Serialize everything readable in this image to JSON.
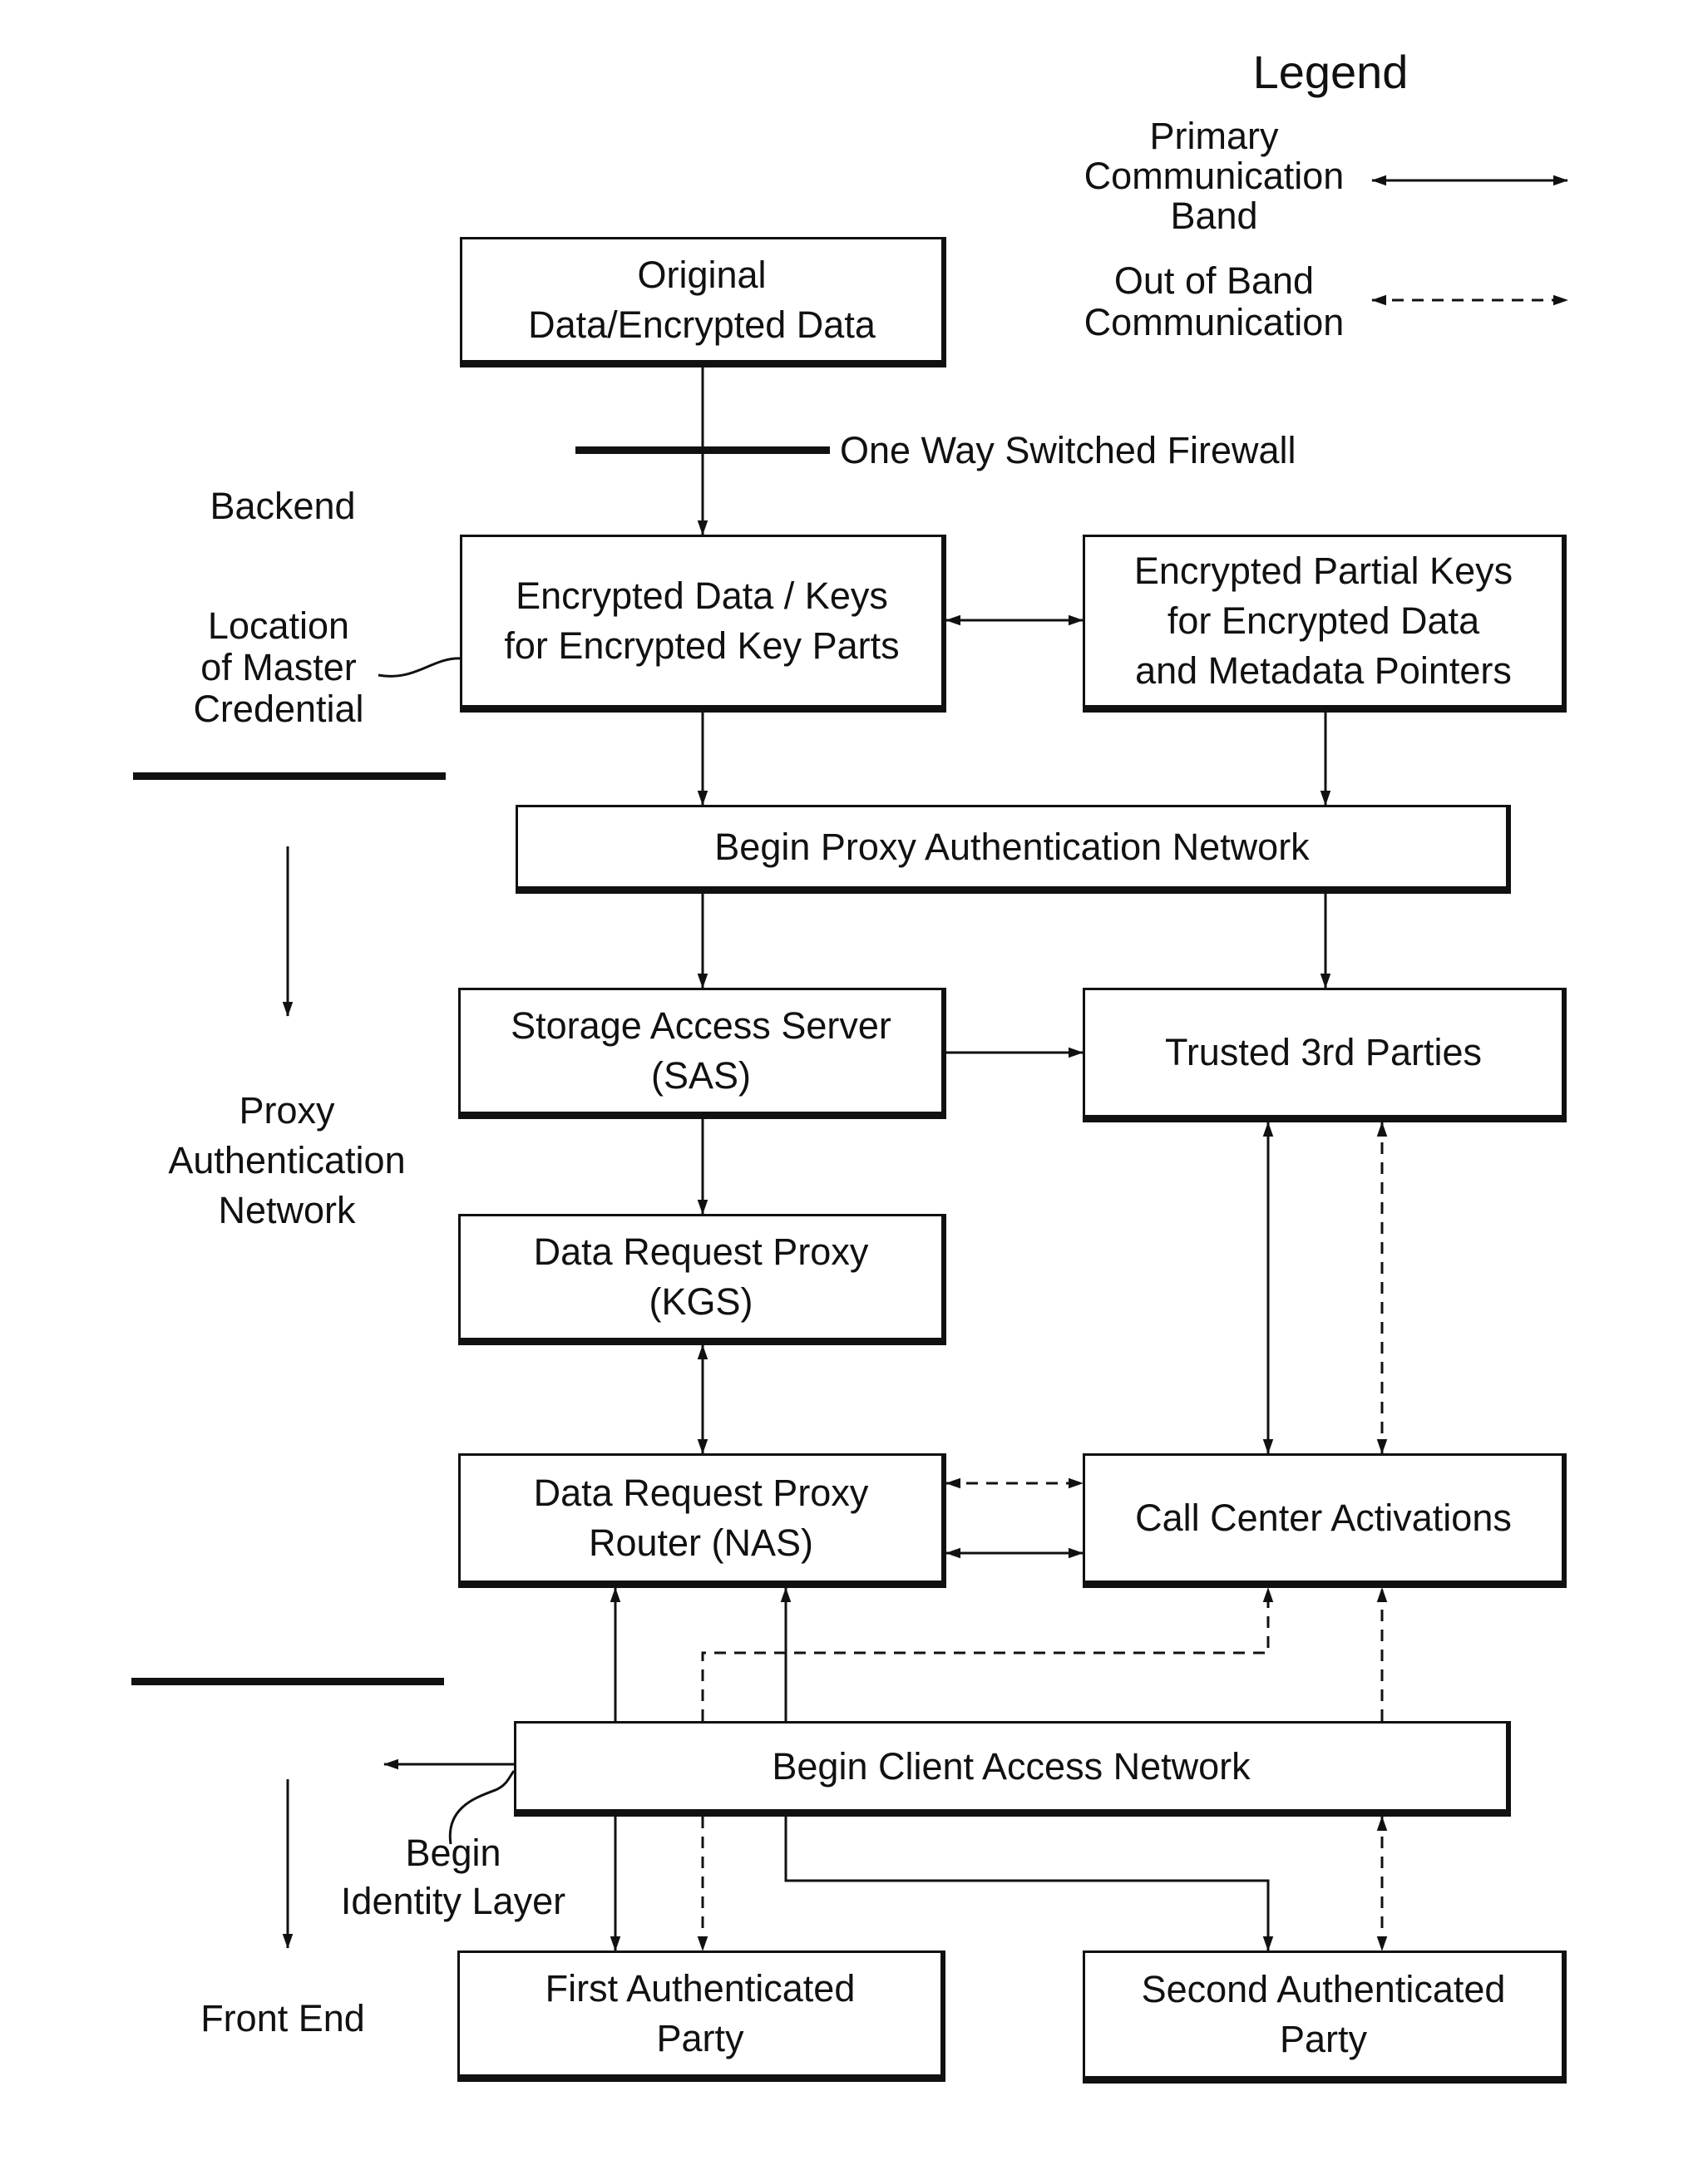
{
  "legend": {
    "title": "Legend",
    "primary_label": "Primary Communication Band",
    "primary_lines": [
      "Primary",
      "Communication",
      "Band"
    ],
    "oob_lines": [
      "Out of Band",
      "Communication"
    ],
    "oob_label": "Out of Band Communication"
  },
  "labels": {
    "firewall": "One Way Switched Firewall",
    "backend": "Backend",
    "master_credential": [
      "Location",
      "of Master",
      "Credential"
    ],
    "proxy_network": [
      "Proxy",
      "Authentication",
      "Network"
    ],
    "identity_layer": [
      "Begin",
      "Identity Layer"
    ],
    "front_end": "Front End"
  },
  "boxes": {
    "original_data": [
      "Original",
      "Data/Encrypted Data"
    ],
    "encrypted_keys": [
      "Encrypted Data / Keys",
      "for Encrypted Key Parts"
    ],
    "partial_keys": [
      "Encrypted Partial Keys",
      "for Encrypted Data",
      "and Metadata Pointers"
    ],
    "begin_proxy": [
      "Begin Proxy Authentication Network"
    ],
    "sas": [
      "Storage Access Server",
      "(SAS)"
    ],
    "trusted": [
      "Trusted 3rd Parties"
    ],
    "kgs": [
      "Data Request Proxy",
      "(KGS)"
    ],
    "nas": [
      "Data Request Proxy",
      "Router (NAS)"
    ],
    "call_center": [
      "Call Center Activations"
    ],
    "begin_client": [
      "Begin Client Access Network"
    ],
    "first_party": [
      "First Authenticated",
      "Party"
    ],
    "second_party": [
      "Second Authenticated",
      "Party"
    ]
  }
}
